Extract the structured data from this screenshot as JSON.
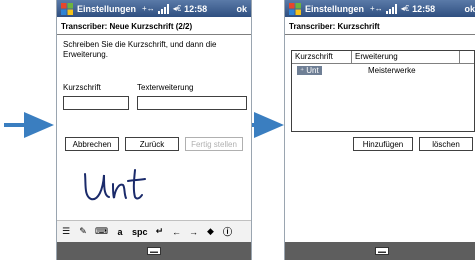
{
  "screen1": {
    "title": "Einstellungen",
    "time": "12:58",
    "ok_label": "ok",
    "heading": "Transcriber: Neue Kurzschrift (2/2)",
    "instruction": "Schreiben Sie die Kurzschrift, und dann die Erweiterung.",
    "shorthand_label": "Kurzschrift",
    "expansion_label": "Texterweiterung",
    "shorthand_value": "",
    "expansion_value": "",
    "cancel_label": "Abbrechen",
    "back_label": "Zurück",
    "finish_label": "Fertig stellen",
    "handwriting_text": "Unt",
    "sip": {
      "spc_label": "spc"
    }
  },
  "screen2": {
    "title": "Einstellungen",
    "time": "12:58",
    "ok_label": "ok",
    "heading": "Transcriber: Kurzschrift",
    "columns": [
      "Kurzschrift",
      "Erweiterung"
    ],
    "rows": [
      {
        "shorthand": "Unt",
        "expansion": "Meisterwerke",
        "selected": true
      }
    ],
    "add_label": "Hinzufügen",
    "delete_label": "löschen"
  },
  "icons": [
    "windows-start-icon",
    "signal-icon",
    "volume-icon",
    "arrow-icon",
    "keyboard-icon"
  ],
  "colors": {
    "titlebar": "#3a5a8a",
    "arrow": "#3a7ec0",
    "menubar": "#5e5e5e",
    "selection": "#6f7f95",
    "handwriting": "#1a2a6a"
  }
}
